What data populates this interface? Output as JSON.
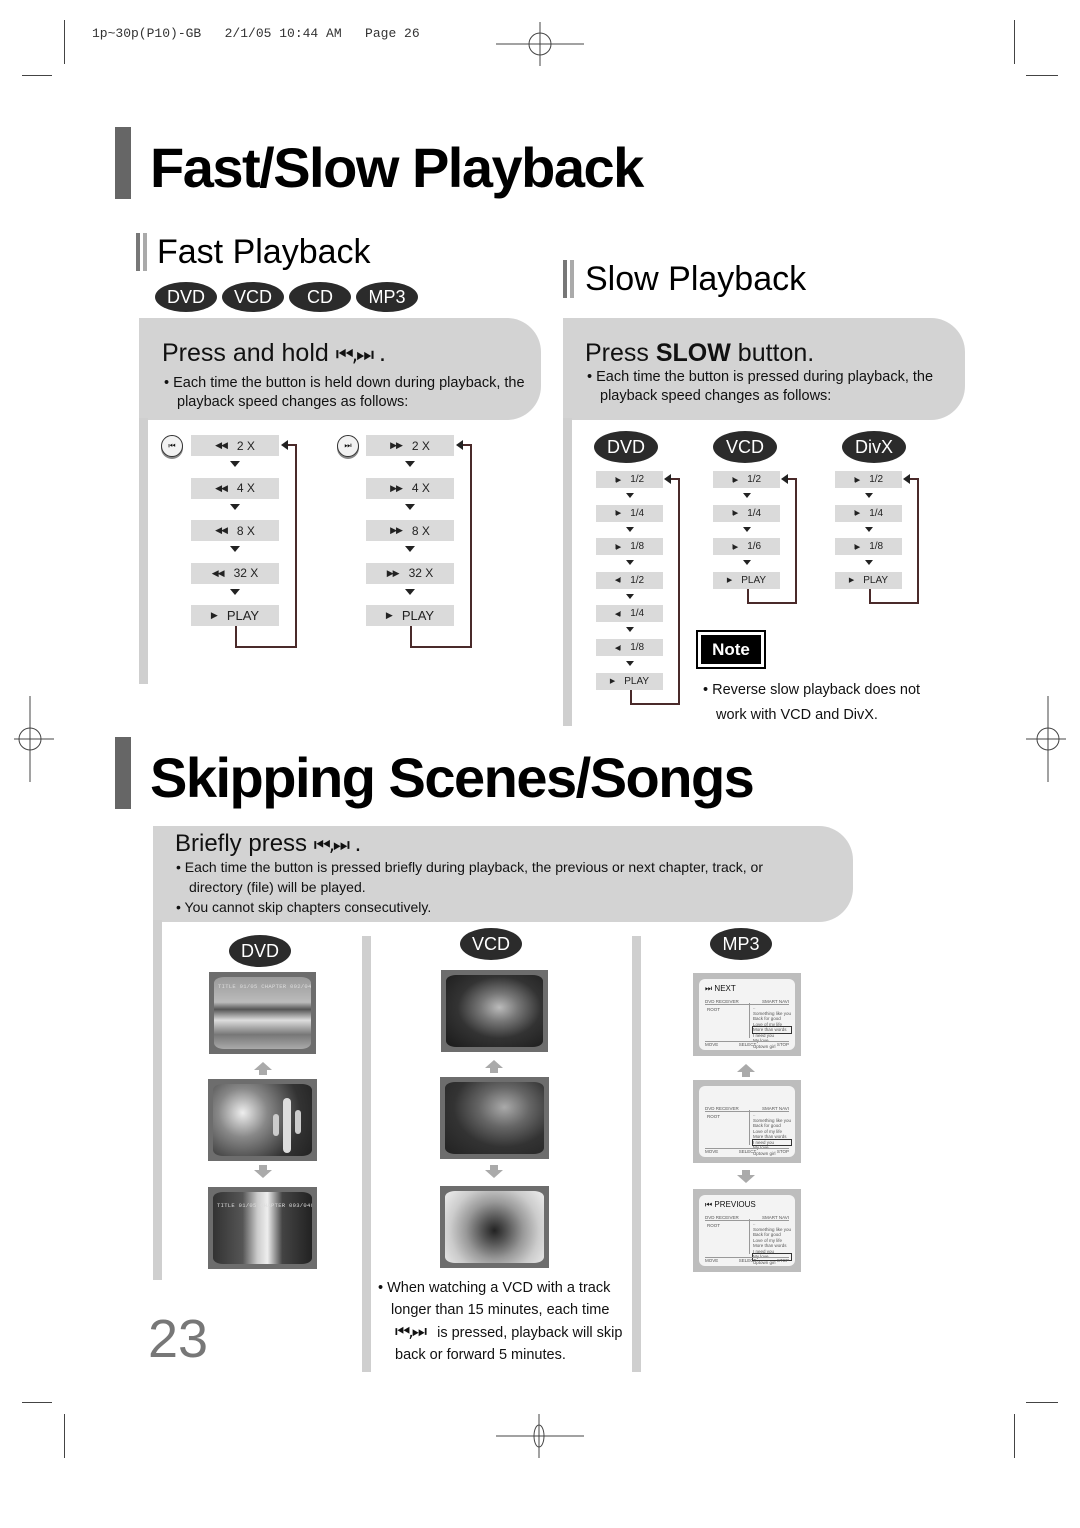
{
  "print_slug": "1p~30p(P10)-GB   2/1/05 10:44 AM   Page 26",
  "fast_slow": {
    "title": "Fast/Slow Playback",
    "fast": {
      "subtitle": "Fast Playback",
      "disc_badges": [
        "DVD",
        "VCD",
        "CD",
        "MP3"
      ],
      "instruction": "Press and hold",
      "instruction_icons": "⏮,⏭",
      "instruction_end": ".",
      "bullet": "Each time the button is held down during playback, the playback speed changes as follows:",
      "reverse": {
        "button_icon": "skip-back-icon",
        "button_glyph": "⏮",
        "steps": [
          {
            "glyph": "◀◀",
            "label": "2 X"
          },
          {
            "glyph": "◀◀",
            "label": "4 X"
          },
          {
            "glyph": "◀◀",
            "label": "8 X"
          },
          {
            "glyph": "◀◀",
            "label": "32 X"
          },
          {
            "glyph": "▶",
            "label": "PLAY"
          }
        ]
      },
      "forward": {
        "button_icon": "skip-forward-icon",
        "button_glyph": "⏭",
        "steps": [
          {
            "glyph": "▶▶",
            "label": "2 X"
          },
          {
            "glyph": "▶▶",
            "label": "4 X"
          },
          {
            "glyph": "▶▶",
            "label": "8 X"
          },
          {
            "glyph": "▶▶",
            "label": "32 X"
          },
          {
            "glyph": "▶",
            "label": "PLAY"
          }
        ]
      }
    },
    "slow": {
      "subtitle": "Slow Playback",
      "instruction_pre": "Press ",
      "instruction_bold": "SLOW",
      "instruction_post": " button.",
      "bullet": "Each time the button is pressed during playback, the playback speed changes as follows:",
      "columns": [
        {
          "badge": "DVD",
          "steps": [
            {
              "glyph": "I▶",
              "label": "1/2"
            },
            {
              "glyph": "I▶",
              "label": "1/4"
            },
            {
              "glyph": "I▶",
              "label": "1/8"
            },
            {
              "glyph": "◀I",
              "label": "1/2"
            },
            {
              "glyph": "◀I",
              "label": "1/4"
            },
            {
              "glyph": "◀I",
              "label": "1/8"
            },
            {
              "glyph": "▶",
              "label": "PLAY"
            }
          ]
        },
        {
          "badge": "VCD",
          "steps": [
            {
              "glyph": "I▶",
              "label": "1/2"
            },
            {
              "glyph": "I▶",
              "label": "1/4"
            },
            {
              "glyph": "I▶",
              "label": "1/6"
            },
            {
              "glyph": "▶",
              "label": "PLAY"
            }
          ]
        },
        {
          "badge": "DivX",
          "steps": [
            {
              "glyph": "I▶",
              "label": "1/2"
            },
            {
              "glyph": "I▶",
              "label": "1/4"
            },
            {
              "glyph": "I▶",
              "label": "1/8"
            },
            {
              "glyph": "▶",
              "label": "PLAY"
            }
          ]
        }
      ],
      "note_label": "Note",
      "note_text": "Reverse slow playback does not work with VCD and DivX."
    }
  },
  "skipping": {
    "title": "Skipping Scenes/Songs",
    "instruction": "Briefly press",
    "instruction_icons": "⏮,⏭",
    "instruction_end": ".",
    "bullets": [
      "Each time the button is pressed briefly during playback, the previous or next chapter, track, or directory (file) will be played.",
      "You cannot skip chapters consecutively."
    ],
    "columns": {
      "dvd": {
        "badge": "DVD",
        "screens": [
          {
            "name": "patio-scene",
            "osd": "TITLE 01/05 CHAPTER 002/040"
          },
          {
            "name": "cactus-scene",
            "osd": ""
          },
          {
            "name": "river-scene",
            "osd": "TITLE 01/05 CHAPTER 003/040"
          }
        ]
      },
      "vcd": {
        "badge": "VCD",
        "screens": [
          {
            "name": "chipmunk-scene"
          },
          {
            "name": "cheetah-scene"
          },
          {
            "name": "raccoon-scene"
          }
        ],
        "note_pre": "When watching a VCD with a track longer than 15 minutes, each time",
        "note_icons": "⏮,⏭",
        "note_post": "is pressed, playback will skip back or forward 5 minutes."
      },
      "mp3": {
        "badge": "MP3",
        "screens": [
          {
            "header": "⏭ NEXT",
            "bar_left": "DVD RECEIVER",
            "bar_right": "SMART NAVI",
            "root": "ROOT",
            "tracks": [
              "..",
              "Something like you",
              "Back for good",
              "Love of my life",
              "More than words",
              "I need you",
              "My love",
              "Uptown girl"
            ],
            "selected": 4,
            "footer": [
              "MOVE",
              "SELECT",
              "STOP"
            ]
          },
          {
            "header": "",
            "bar_left": "DVD RECEIVER",
            "bar_right": "SMART NAVI",
            "root": "ROOT",
            "tracks": [
              "..",
              "Something like you",
              "Back for good",
              "Love of my life",
              "More than words",
              "I need you",
              "My love",
              "Uptown girl"
            ],
            "selected": 5,
            "footer": [
              "MOVE",
              "SELECT",
              "STOP"
            ]
          },
          {
            "header": "⏮ PREVIOUS",
            "bar_left": "DVD RECEIVER",
            "bar_right": "SMART NAVI",
            "root": "ROOT",
            "tracks": [
              "..",
              "Something like you",
              "Back for good",
              "Love of my life",
              "More than words",
              "I need you",
              "My love",
              "Uptown girl"
            ],
            "selected": 6,
            "footer": [
              "MOVE",
              "SELECT",
              "STOP"
            ]
          }
        ]
      }
    }
  },
  "page_number": "23"
}
